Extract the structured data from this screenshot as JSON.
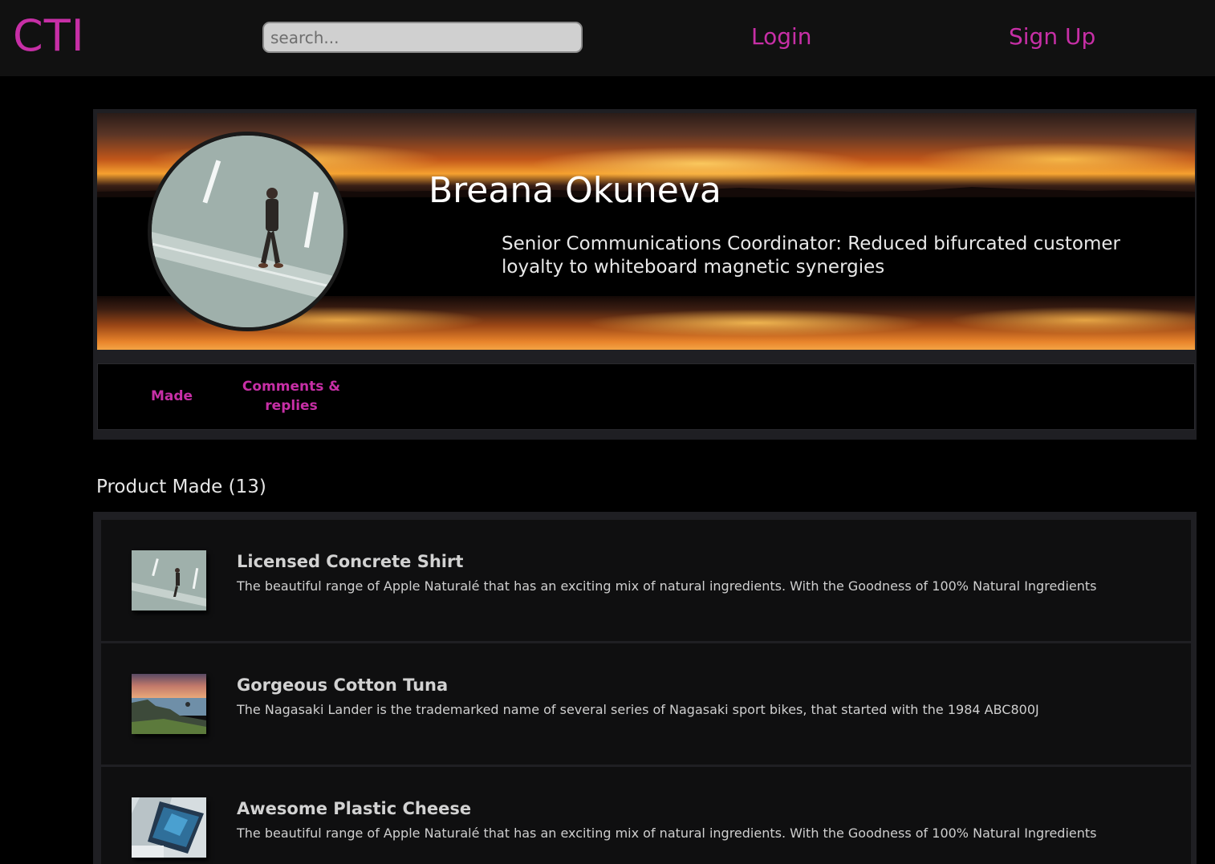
{
  "header": {
    "brand": "CTI",
    "search_placeholder": "search...",
    "login_label": "Login",
    "signup_label": "Sign Up"
  },
  "profile": {
    "name": "Breana Okuneva",
    "bio": "Senior Communications Coordinator: Reduced bifurcated customer loyalty to whiteboard magnetic synergies",
    "tabs": [
      {
        "label": "Made"
      },
      {
        "label": "Comments & replies"
      }
    ]
  },
  "products": {
    "section_title": "Product Made (13)",
    "items": [
      {
        "title": "Licensed Concrete Shirt",
        "description": "The beautiful range of Apple Naturalé that has an exciting mix of natural ingredients. With the Goodness of 100% Natural Ingredients",
        "thumbnail": "person-walking-photo"
      },
      {
        "title": "Gorgeous Cotton Tuna",
        "description": "The Nagasaki Lander is the trademarked name of several series of Nagasaki sport bikes, that started with the 1984 ABC800J",
        "thumbnail": "coastline-sunset-photo"
      },
      {
        "title": "Awesome Plastic Cheese",
        "description": "The beautiful range of Apple Naturalé that has an exciting mix of natural ingredients. With the Goodness of 100% Natural Ingredients",
        "thumbnail": "laptop-desk-photo"
      }
    ]
  },
  "colors": {
    "accent": "#c72fa6",
    "nav_background": "#111111",
    "page_background": "#000000",
    "card_background": "#1f1f23",
    "item_background": "#0f0f10"
  }
}
